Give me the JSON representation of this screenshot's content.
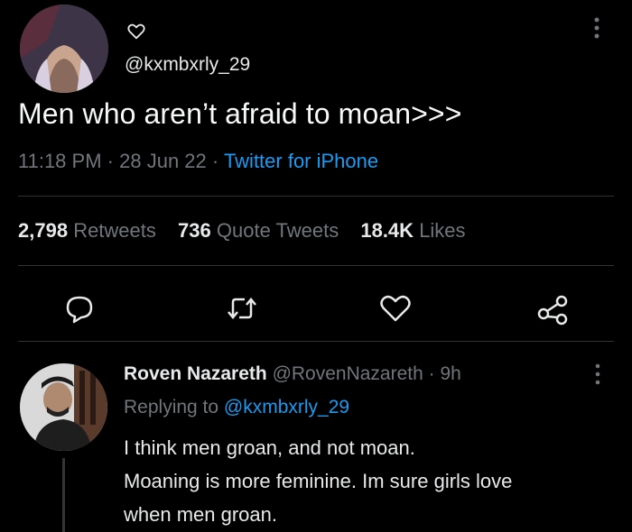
{
  "tweet": {
    "handle": "@kxmbxrly_29",
    "text": "Men who aren’t afraid to moan>>>",
    "time": "11:18 PM",
    "dot": "·",
    "date": "28 Jun 22",
    "source": "Twitter for iPhone",
    "stats": {
      "retweets_count": "2,798",
      "retweets_label": "Retweets",
      "quotes_count": "736",
      "quotes_label": "Quote Tweets",
      "likes_count": "18.4K",
      "likes_label": "Likes"
    },
    "actions": [
      "reply-icon",
      "retweet-icon",
      "like-icon",
      "share-icon"
    ]
  },
  "reply": {
    "name": "Roven Nazareth",
    "handle": "@RovenNazareth",
    "dot": "·",
    "age": "9h",
    "replying_prefix": "Replying to",
    "replying_to": "@kxmbxrly_29",
    "text_line1": "I think men groan, and not moan.",
    "text_line2": "Moaning is more feminine. Im sure girls love",
    "text_line3": "when men groan."
  },
  "colors": {
    "background": "#000000",
    "text": "#e7e9ea",
    "muted": "#71767b",
    "accent": "#1d9bf0",
    "divider": "#2f3336"
  }
}
